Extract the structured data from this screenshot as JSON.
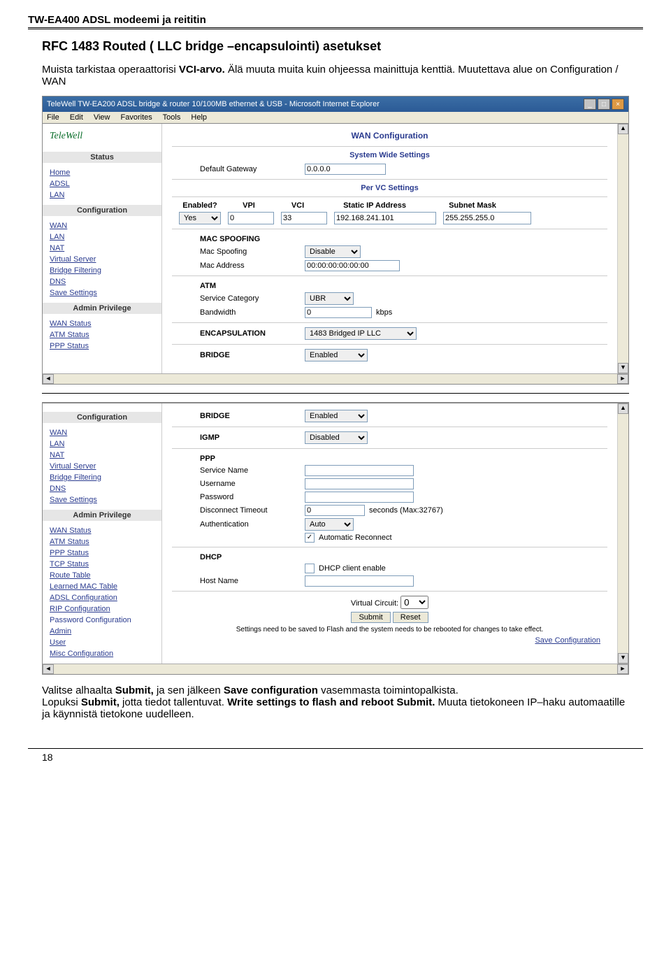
{
  "doc_header": "TW-EA400 ADSL modeemi ja reititin",
  "title": "RFC 1483 Routed ( LLC bridge –encapsulointi) asetukset",
  "intro_plain1": "Muista tarkistaa operaattorisi ",
  "intro_bold1": "VCI-arvo.",
  "intro_plain2": " Älä muuta muita kuin ohjeessa mainittuja kenttiä. Muutettava alue on Configuration / WAN",
  "browser": {
    "title": "TeleWell TW-EA200 ADSL bridge & router 10/100MB ethernet & USB - Microsoft Internet Explorer",
    "menu": [
      "File",
      "Edit",
      "View",
      "Favorites",
      "Tools",
      "Help"
    ]
  },
  "logo": "TeleWell",
  "nav": {
    "status_heading": "Status",
    "status_items": [
      "Home",
      "ADSL",
      "LAN"
    ],
    "config_heading": "Configuration",
    "config_items": [
      "WAN",
      "LAN",
      "NAT",
      "Virtual Server",
      "Bridge Filtering",
      "DNS",
      "Save Settings"
    ],
    "admin_heading": "Admin Privilege",
    "admin_items": [
      "WAN Status",
      "ATM Status",
      "PPP Status"
    ],
    "admin_items2": [
      "WAN Status",
      "ATM Status",
      "PPP Status",
      "TCP Status",
      "Route Table",
      "Learned MAC Table",
      "ADSL Configuration",
      "RIP Configuration",
      "Password Configuration",
      "Admin",
      "User",
      "Misc Configuration"
    ]
  },
  "shot1": {
    "h1": "WAN Configuration",
    "h2": "System Wide Settings",
    "def_gw_label": "Default Gateway",
    "def_gw_value": "0.0.0.0",
    "per_vc": "Per VC Settings",
    "th": {
      "c1": "Enabled?",
      "c2": "VPI",
      "c3": "VCI",
      "c4": "Static IP Address",
      "c5": "Subnet Mask"
    },
    "tr": {
      "enabled": "Yes",
      "vpi": "0",
      "vci": "33",
      "ip": "192.168.241.101",
      "mask": "255.255.255.0"
    },
    "mac_spoof_h": "MAC SPOOFING",
    "mac_spoof_lbl": "Mac Spoofing",
    "mac_spoof_val": "Disable",
    "mac_addr_lbl": "Mac Address",
    "mac_addr_val": "00:00:00:00:00:00",
    "atm_h": "ATM",
    "svc_cat_lbl": "Service Category",
    "svc_cat_val": "UBR",
    "bw_lbl": "Bandwidth",
    "bw_val": "0",
    "bw_unit": "kbps",
    "encap_lbl": "ENCAPSULATION",
    "encap_val": "1483 Bridged IP LLC",
    "bridge_lbl": "BRIDGE",
    "bridge_val": "Enabled"
  },
  "shot2": {
    "bridge_lbl": "BRIDGE",
    "bridge_val": "Enabled",
    "igmp_lbl": "IGMP",
    "igmp_val": "Disabled",
    "ppp_h": "PPP",
    "svc_name_lbl": "Service Name",
    "user_lbl": "Username",
    "pwd_lbl": "Password",
    "disc_lbl": "Disconnect Timeout",
    "disc_val": "0",
    "disc_unit": "seconds (Max:32767)",
    "auth_lbl": "Authentication",
    "auth_val": "Auto",
    "auto_rec": "Automatic Reconnect",
    "dhcp_h": "DHCP",
    "dhcp_chk": "DHCP client enable",
    "host_lbl": "Host Name",
    "vc_lbl": "Virtual Circuit:",
    "vc_val": "0",
    "submit": "Submit",
    "reset": "Reset",
    "msg": "Settings need to be saved to Flash and the system needs to be rebooted for changes to take effect.",
    "save": "Save Configuration"
  },
  "outro": [
    "Valitse alhaalta ",
    "Submit,",
    " ja sen jälkeen ",
    "Save configuration",
    " vasemmasta toimintopalkista.",
    "Lopuksi ",
    "Submit,",
    " jotta tiedot tallentuvat. ",
    "Write settings to flash and reboot Submit.",
    " Muuta tietokoneen IP–haku automaatille ja käynnistä tietokone uudelleen."
  ],
  "page_no": "18"
}
